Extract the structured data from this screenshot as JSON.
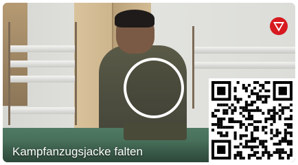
{
  "video": {
    "title": "Kampfanzugsjacke falten"
  },
  "icons": {
    "play": "play-icon",
    "brand": "red-triangle-logo",
    "qr": "qr-code"
  },
  "colors": {
    "brand_red": "#d71920",
    "overlay_text": "#ffffff",
    "play_ring": "#ffffff"
  }
}
